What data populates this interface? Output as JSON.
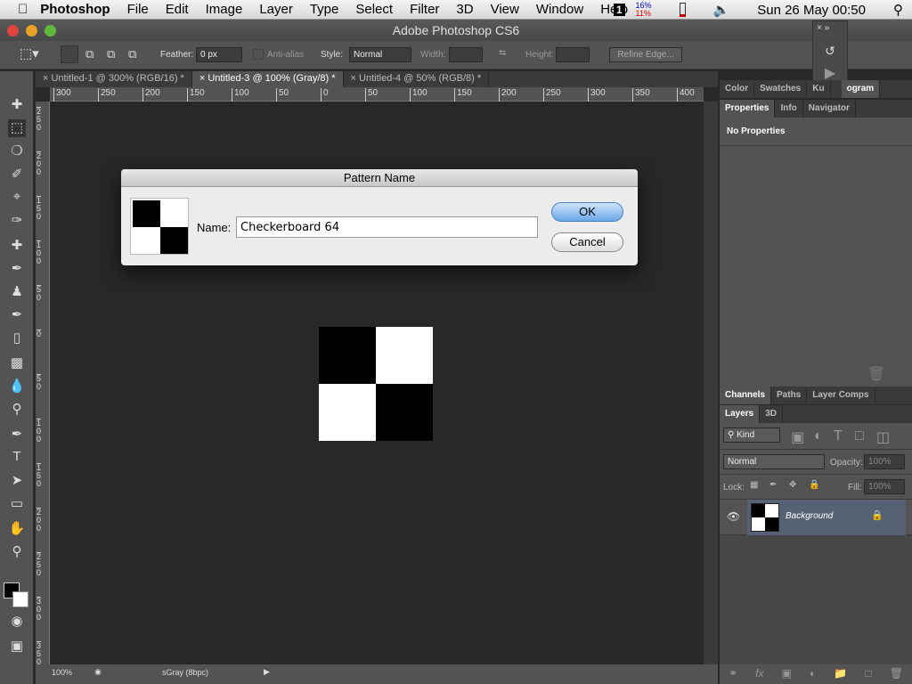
{
  "menubar": {
    "app": "Photoshop",
    "items": [
      "File",
      "Edit",
      "Image",
      "Layer",
      "Type",
      "Select",
      "Filter",
      "3D",
      "View",
      "Window",
      "Help"
    ],
    "cpu_top": "16%",
    "cpu_bottom": "11%",
    "datetime": "Sun 26 May  00:50",
    "space_number": "1"
  },
  "window": {
    "title": "Adobe Photoshop CS6"
  },
  "options": {
    "feather_label": "Feather:",
    "feather_value": "0 px",
    "antialias_label": "Anti-alias",
    "style_label": "Style:",
    "style_value": "Normal",
    "width_label": "Width:",
    "height_label": "Height:",
    "refine_edge": "Refine Edge..."
  },
  "tabs": [
    {
      "label": "Untitled-1 @ 300% (RGB/16) *"
    },
    {
      "label": "Untitled-3 @ 100% (Gray/8) *"
    },
    {
      "label": "Untitled-4 @ 50% (RGB/8) *"
    }
  ],
  "ruler_top": [
    "300",
    "250",
    "200",
    "150",
    "100",
    "50",
    "0",
    "50",
    "100",
    "150",
    "200",
    "250",
    "300",
    "350",
    "400"
  ],
  "ruler_left": [
    "250",
    "200",
    "150",
    "100",
    "50",
    "0",
    "50",
    "100",
    "150",
    "200",
    "250",
    "300",
    "350"
  ],
  "status": {
    "zoom": "100%",
    "profile": "sGray (8bpc)"
  },
  "dialog": {
    "title": "Pattern Name",
    "name_label": "Name:",
    "name_value": "Checkerboard 64",
    "ok": "OK",
    "cancel": "Cancel"
  },
  "panels": {
    "top_tabs": [
      "Color",
      "Swatches",
      "Ku",
      "ogram"
    ],
    "props_tabs": [
      "Properties",
      "Info",
      "Navigator"
    ],
    "no_properties": "No Properties",
    "channel_tabs": [
      "Channels",
      "Paths",
      "Layer Comps"
    ],
    "layer_tabs": [
      "Layers",
      "3D"
    ],
    "kind": "Kind",
    "blend_mode": "Normal",
    "opacity_label": "Opacity:",
    "opacity_value": "100%",
    "lock_label": "Lock:",
    "fill_label": "Fill:",
    "fill_value": "100%",
    "layer_name": "Background"
  }
}
